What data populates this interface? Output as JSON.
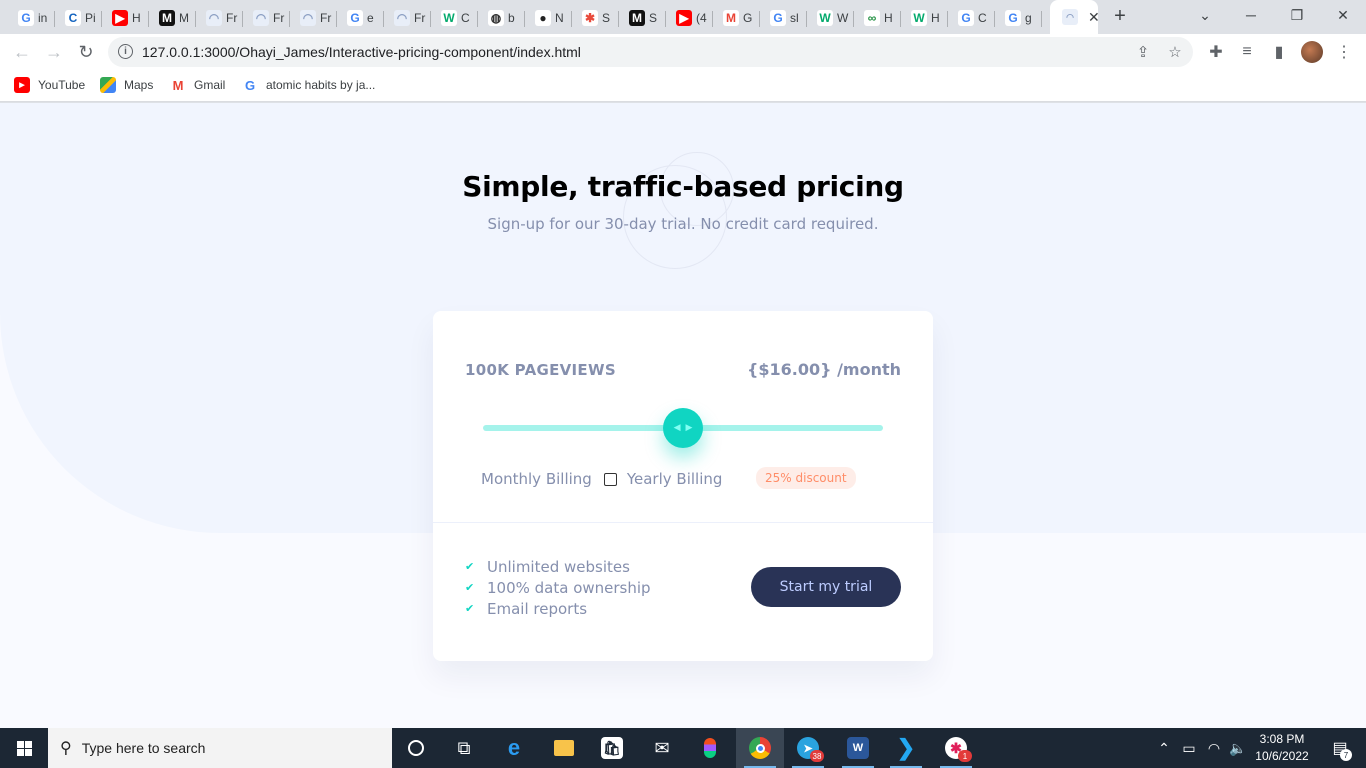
{
  "browser": {
    "tabs": [
      {
        "favicon": "google-icon",
        "label": "in"
      },
      {
        "favicon": "chegg-icon",
        "label": "Pi"
      },
      {
        "favicon": "youtube-icon",
        "label": "H"
      },
      {
        "favicon": "m-icon",
        "label": "M"
      },
      {
        "favicon": "frontend-icon",
        "label": "Fr"
      },
      {
        "favicon": "frontend-icon",
        "label": "Fr"
      },
      {
        "favicon": "frontend-icon",
        "label": "Fr"
      },
      {
        "favicon": "google-icon",
        "label": "e"
      },
      {
        "favicon": "frontend-icon",
        "label": "Fr"
      },
      {
        "favicon": "w3-icon",
        "label": "C"
      },
      {
        "favicon": "globe-icon",
        "label": "b"
      },
      {
        "favicon": "github-icon",
        "label": "N"
      },
      {
        "favicon": "star-icon",
        "label": "S"
      },
      {
        "favicon": "m-icon",
        "label": "S"
      },
      {
        "favicon": "youtube-icon",
        "label": "(4"
      },
      {
        "favicon": "gmail-icon",
        "label": "G"
      },
      {
        "favicon": "google-icon",
        "label": "sl"
      },
      {
        "favicon": "w3-icon",
        "label": "W"
      },
      {
        "favicon": "loop-icon",
        "label": "H"
      },
      {
        "favicon": "w3-icon",
        "label": "H"
      },
      {
        "favicon": "google-icon",
        "label": "C"
      },
      {
        "favicon": "google-icon",
        "label": "g"
      }
    ],
    "active_tab_favicon": "frontend-icon",
    "url": "127.0.0.1:3000/Ohayi_James/Interactive-pricing-component/index.html",
    "bookmarks": [
      {
        "label": "YouTube",
        "icon": "youtube-icon"
      },
      {
        "label": "Maps",
        "icon": "maps-icon"
      },
      {
        "label": "Gmail",
        "icon": "gmail-icon"
      },
      {
        "label": "atomic habits by ja...",
        "icon": "google-icon"
      }
    ]
  },
  "page": {
    "title": "Simple, traffic-based pricing",
    "subtitle": "Sign-up for our 30-day trial. No credit card required.",
    "pageviews": "100K PAGEVIEWS",
    "price": "{$16.00}",
    "price_period": "/month",
    "slider_value": 0.5,
    "monthly_label": "Monthly Billing",
    "yearly_label": "Yearly Billing",
    "yearly_checked": false,
    "discount": "25% discount",
    "features": [
      "Unlimited websites",
      "100% data ownership",
      "Email reports"
    ],
    "cta": "Start my trial",
    "colors": {
      "slider_fill": "#a5f3eb",
      "slider_thumb": "#10d5c2",
      "cta_background": "#293356",
      "discount_text": "#ff8d68"
    }
  },
  "taskbar": {
    "search_placeholder": "Type here to search",
    "telegram_badge": "38",
    "slack_badge": "1",
    "time": "3:08 PM",
    "date": "10/6/2022",
    "notifications": "7"
  }
}
